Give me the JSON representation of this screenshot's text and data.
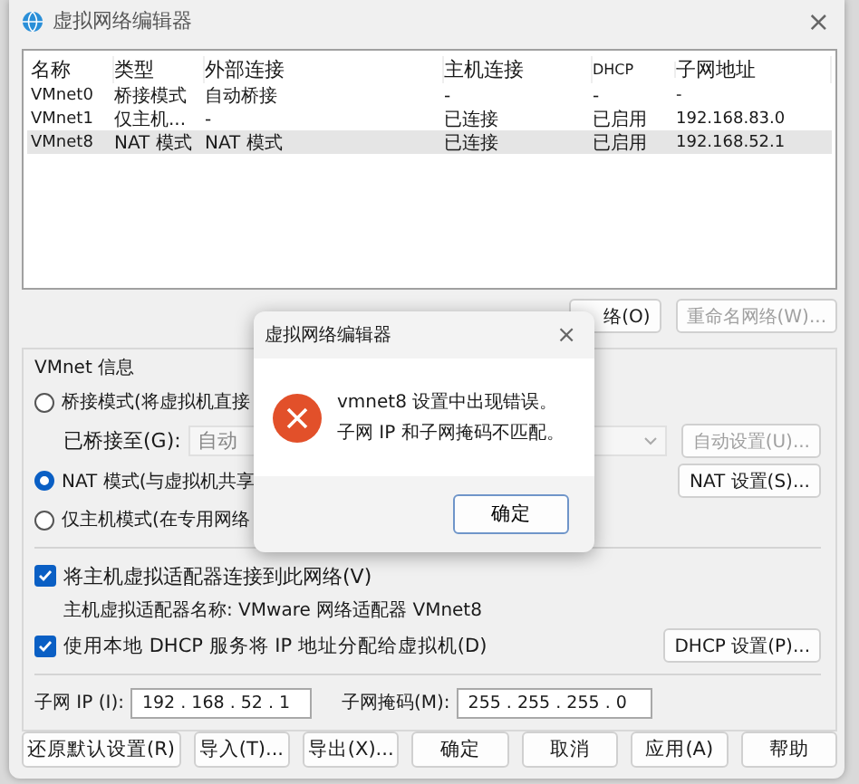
{
  "window": {
    "title": "虚拟网络编辑器",
    "close": "×"
  },
  "table": {
    "columns": [
      "名称",
      "类型",
      "外部连接",
      "主机连接",
      "DHCP",
      "子网地址"
    ],
    "rows": [
      {
        "cells": [
          "VMnet0",
          "桥接模式",
          "自动桥接",
          "-",
          "-",
          "-"
        ],
        "selected": false
      },
      {
        "cells": [
          "VMnet1",
          "仅主机...",
          "-",
          "已连接",
          "已启用",
          "192.168.83.0"
        ],
        "selected": false
      },
      {
        "cells": [
          "VMnet8",
          "NAT 模式",
          "NAT 模式",
          "已连接",
          "已启用",
          "192.168.52.1"
        ],
        "selected": true
      }
    ]
  },
  "network_buttons": [
    {
      "label": "络(O)",
      "disabled": false
    },
    {
      "label": "重命名网络(W)...",
      "disabled": true
    }
  ],
  "vmnet_info": {
    "title": "VMnet 信息",
    "bridged": {
      "label": "桥接模式(将虚拟机直接",
      "selected": false
    },
    "bridged_to": {
      "label": "已桥接至(G):",
      "value": "自动",
      "disabled": true
    },
    "auto_settings": {
      "label": "自动设置(U)...",
      "disabled": true
    },
    "nat": {
      "label": "NAT 模式(与虚拟机共享",
      "selected": true
    },
    "nat_settings": {
      "label": "NAT 设置(S)...",
      "disabled": false
    },
    "host_only": {
      "label": "仅主机模式(在专用网络",
      "selected": false
    },
    "connect_adapter": {
      "label": "将主机虚拟适配器连接到此网络(V)",
      "checked": true
    },
    "adapter_name": "主机虚拟适配器名称: VMware 网络适配器 VMnet8",
    "use_dhcp": {
      "label": "使用本地 DHCP 服务将 IP 地址分配给虚拟机(D)",
      "checked": true
    },
    "dhcp_settings": {
      "label": "DHCP 设置(P)...",
      "disabled": false
    },
    "subnet_ip": {
      "label": "子网 IP (I):",
      "value": "192 . 168 . 52 . 1"
    },
    "subnet_mask": {
      "label": "子网掩码(M):",
      "value": "255 . 255 . 255 . 0"
    }
  },
  "footer_buttons": [
    "还原默认设置(R)",
    "导入(T)...",
    "导出(X)...",
    "确定",
    "取消",
    "应用(A)",
    "帮助"
  ],
  "error_dialog": {
    "title": "虚拟网络编辑器",
    "close": "×",
    "message": [
      "vmnet8 设置中出现错误。",
      "子网 IP 和子网掩码不匹配。"
    ],
    "button": "确定"
  }
}
